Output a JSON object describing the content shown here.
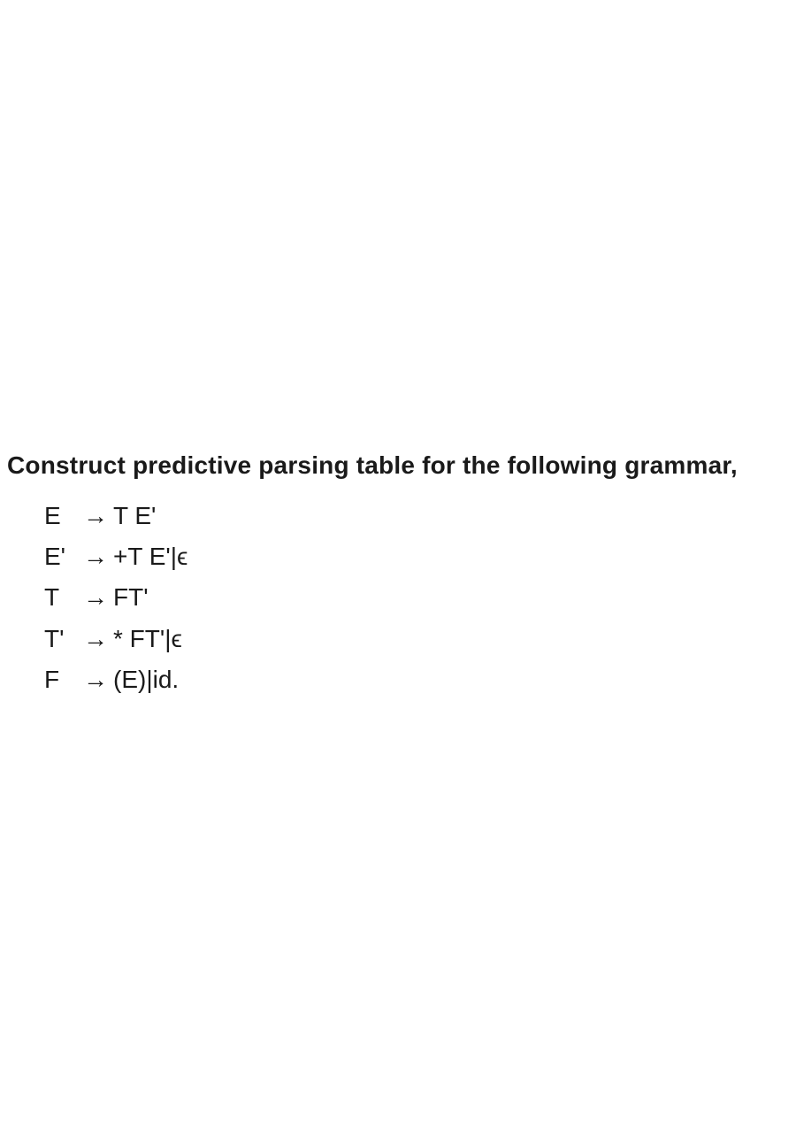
{
  "heading": "Construct predictive parsing table for the following grammar,",
  "rules": [
    {
      "lhs": "E",
      "arrow": "→",
      "rhs": "T E'"
    },
    {
      "lhs": "E'",
      "arrow": "→",
      "rhs": "+T E'|ϵ"
    },
    {
      "lhs": "T",
      "arrow": "→",
      "rhs": "FT'"
    },
    {
      "lhs": "T'",
      "arrow": "→",
      "rhs": "* FT'|ϵ"
    },
    {
      "lhs": "F",
      "arrow": "→",
      "rhs": "(E)|id."
    }
  ]
}
